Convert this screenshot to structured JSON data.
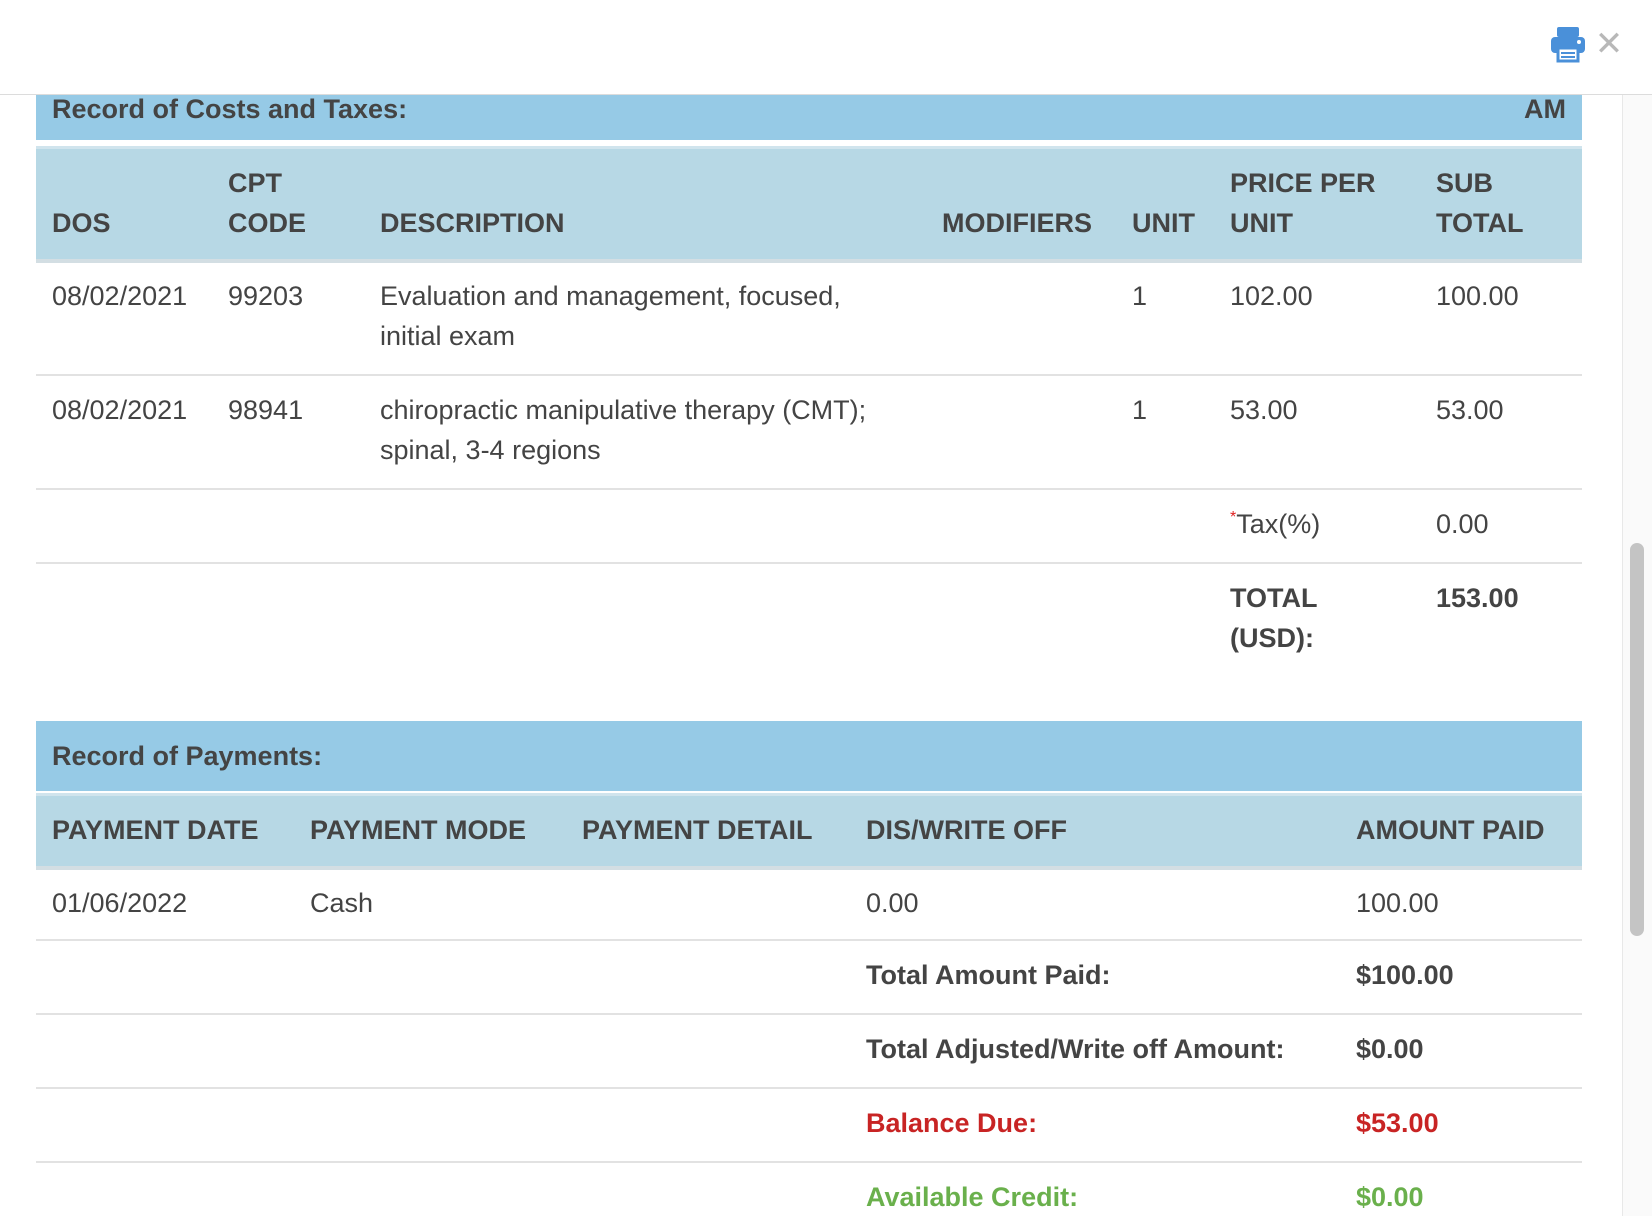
{
  "toolbar": {
    "print_icon": "printer-icon",
    "close_icon": "close-icon",
    "close_glyph": "✕"
  },
  "costs": {
    "title": "Record of Costs and Taxes:",
    "title_right": "AM",
    "headers": {
      "dos": "DOS",
      "cpt_line1": "CPT",
      "cpt_line2": "CODE",
      "description": "DESCRIPTION",
      "modifiers": "MODIFIERS",
      "unit": "UNIT",
      "price_line1": "PRICE PER",
      "price_line2": "UNIT",
      "sub_line1": "SUB",
      "sub_line2": "TOTAL"
    },
    "rows": [
      {
        "dos": "08/02/2021",
        "cpt": "99203",
        "desc_line1": "Evaluation and management, focused,",
        "desc_line2": "initial exam",
        "modifiers": "",
        "unit": "1",
        "price": "102.00",
        "subtotal": "100.00"
      },
      {
        "dos": "08/02/2021",
        "cpt": "98941",
        "desc_line1": "chiropractic manipulative therapy (CMT);",
        "desc_line2": "spinal, 3-4 regions",
        "modifiers": "",
        "unit": "1",
        "price": "53.00",
        "subtotal": "53.00"
      }
    ],
    "tax": {
      "required_mark": "*",
      "label": "Tax(%)",
      "value": "0.00"
    },
    "total": {
      "label_line1": "TOTAL",
      "label_line2": "(USD):",
      "value": "153.00"
    }
  },
  "payments": {
    "title": "Record of Payments:",
    "headers": {
      "date": "PAYMENT DATE",
      "mode": "PAYMENT MODE",
      "detail": "PAYMENT DETAIL",
      "writeoff": "DIS/WRITE OFF",
      "amount": "AMOUNT PAID"
    },
    "rows": [
      {
        "date": "01/06/2022",
        "mode": "Cash",
        "detail": "",
        "writeoff": "0.00",
        "amount": "100.00"
      }
    ],
    "summary": {
      "total_paid_label": "Total Amount Paid:",
      "total_paid_value": "$100.00",
      "adjusted_label": "Total Adjusted/Write off Amount:",
      "adjusted_value": "$0.00",
      "balance_label": "Balance Due:",
      "balance_value": "$53.00",
      "credit_label": "Available Credit:",
      "credit_value": "$0.00"
    }
  },
  "colors": {
    "section_header": "#96cae6",
    "table_header": "#b7d8e5",
    "balance_due": "#c82424",
    "available_credit": "#6ab04c",
    "print_icon": "#4a90d9"
  }
}
